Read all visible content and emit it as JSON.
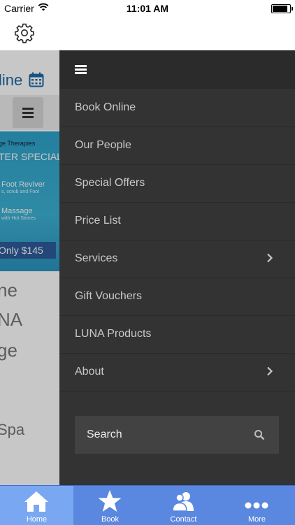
{
  "status_bar": {
    "carrier": "Carrier",
    "time": "11:01 AM",
    "battery_level": 0.95
  },
  "underlay": {
    "book_text": "line",
    "banner": {
      "line1": "ge Therapies",
      "line2": "TER SPECIAL",
      "line3": "Foot Reviver",
      "line4": "s, scrub and Foot",
      "line5": "Massage",
      "line6": "with Hot Stones",
      "price": "Only $145"
    },
    "body_lines": [
      "ne",
      "NA",
      "ge",
      "Spa"
    ]
  },
  "drawer": {
    "items": [
      {
        "label": "Book Online",
        "has_submenu": false
      },
      {
        "label": "Our People",
        "has_submenu": false
      },
      {
        "label": "Special Offers",
        "has_submenu": false
      },
      {
        "label": "Price List",
        "has_submenu": false
      },
      {
        "label": "Services",
        "has_submenu": true
      },
      {
        "label": "Gift Vouchers",
        "has_submenu": false
      },
      {
        "label": "LUNA Products",
        "has_submenu": false
      },
      {
        "label": "About",
        "has_submenu": true
      }
    ],
    "search_placeholder": "Search"
  },
  "tab_bar": {
    "tabs": [
      {
        "label": "Home",
        "icon": "home-icon",
        "active": true
      },
      {
        "label": "Book",
        "icon": "star-icon",
        "active": false
      },
      {
        "label": "Contact",
        "icon": "people-icon",
        "active": false
      },
      {
        "label": "More",
        "icon": "more-icon",
        "active": false
      }
    ]
  },
  "colors": {
    "drawer_bg": "#333333",
    "tab_bar_bg": "#5a87e0",
    "tab_active_bg": "#7aa7f2",
    "accent_blue": "#1f6aa8"
  }
}
